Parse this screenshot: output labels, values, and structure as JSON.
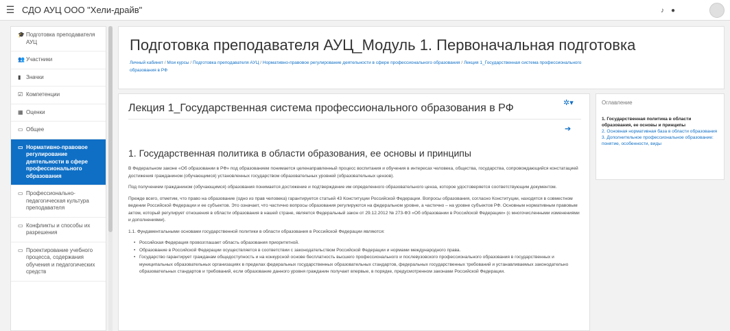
{
  "navbar": {
    "menu_icon": "hamburger-icon",
    "site_name": "СДО АУЦ ООО \"Хели-драйв\""
  },
  "sidebar": {
    "items": [
      {
        "icon": "graduation-cap-icon",
        "glyph": "🎓",
        "label": "Подготовка преподавателя АУЦ"
      },
      {
        "icon": "users-icon",
        "glyph": "👥",
        "label": "Участники"
      },
      {
        "icon": "badge-icon",
        "glyph": "▮",
        "label": "Значки"
      },
      {
        "icon": "check-square-icon",
        "glyph": "☑",
        "label": "Компетенции"
      },
      {
        "icon": "grades-icon",
        "glyph": "▦",
        "label": "Оценки"
      },
      {
        "icon": "folder-icon",
        "glyph": "▭",
        "label": "Общее"
      },
      {
        "icon": "folder-icon",
        "glyph": "▭",
        "label": "Нормативно-правовое регулирование деятельности в сфере профессионального образования",
        "active": true
      },
      {
        "icon": "folder-icon",
        "glyph": "▭",
        "label": "Профессионально-педагогическая культура преподавателя"
      },
      {
        "icon": "folder-icon",
        "glyph": "▭",
        "label": "Конфликты и способы их разрешения"
      },
      {
        "icon": "folder-icon",
        "glyph": "▭",
        "label": "Проектирование учебного процесса, содержания обучения и педагогических средств"
      }
    ]
  },
  "header": {
    "course_title": "Подготовка преподавателя АУЦ_Модуль 1. Первоначальная подготовка",
    "breadcrumb": [
      "Личный кабинет",
      "Мои курсы",
      "Подготовка преподавателя АУЦ",
      "Нормативно-правовое регулирование деятельности в сфере профессионального образования",
      "Лекция 1_Государственная система профессионального образования в РФ"
    ],
    "breadcrumb_separator": "/"
  },
  "lesson": {
    "title": "Лекция 1_Государственная система профессионального образования в РФ",
    "gear_icon": "gear-icon",
    "next_icon": "arrow-right-icon",
    "section_heading": "1. Государственная политика в области образования, ее основы и принципы",
    "paragraphs": [
      "В Федеральном законе «Об образовании в РФ» под образованием понимается целенаправленный процесс воспитания и обучения в интересах человека, общества, государства, сопровождающийся констатацией достижения гражданином (обучающимся) установленных государством образовательных уровней (образовательных цензов).",
      "Под получением гражданином (обучающимся) образования понимается достижение и подтверждение им определенного образовательного ценза, которое удостоверяется соответствующим документом.",
      "Прежде всего, отметим, что право на образование (одно из прав человека) гарантируется статьей 43 Конституции Российской Федерации. Вопросы образования, согласно Конституции, находятся в совместном ведении Российской Федерации и ее субъектов. Это означает, что частично вопросы образования регулируются на федеральном уровне, а частично – на уровне субъектов РФ. Основным нормативным правовым актом, который регулирует отношения в области образования в нашей стране, является Федеральный закон от 29.12.2012 № 273-ФЗ «Об образовании в Российской Федерации» (с многочисленными изменениями и дополнениями).",
      "1.1. Фундаментальными основами государственной политики в области образования в Российской Федерации являются:"
    ],
    "bullets": [
      "Российская Федерация провозглашает область образования приоритетной.",
      "Образование в Российской Федерации осуществляется в соответствии с законодательством Российской Федерации и нормами международного права.",
      "Государство гарантирует гражданам общедоступность и на конкурсной основе бесплатность высшего профессионального и послевузовского профессионального образования в государственных и муниципальных образовательных организациях в пределах федеральных государственных образовательных стандартов, федеральных государственных требований и устанавливаемых законодательно образовательных стандартов и требований, если образование данного уровня гражданин получает впервые, в порядке, предусмотренном законами Российской Федерации."
    ]
  },
  "toc": {
    "title": "Оглавление",
    "items": [
      {
        "label": "1. Государственная политика в области образования, ее основы и принципы",
        "current": true
      },
      {
        "label": "2. Основная нормативная база в области образования"
      },
      {
        "label": "3. Дополнительное профессиональное образование: понятие, особенности, виды"
      }
    ]
  }
}
